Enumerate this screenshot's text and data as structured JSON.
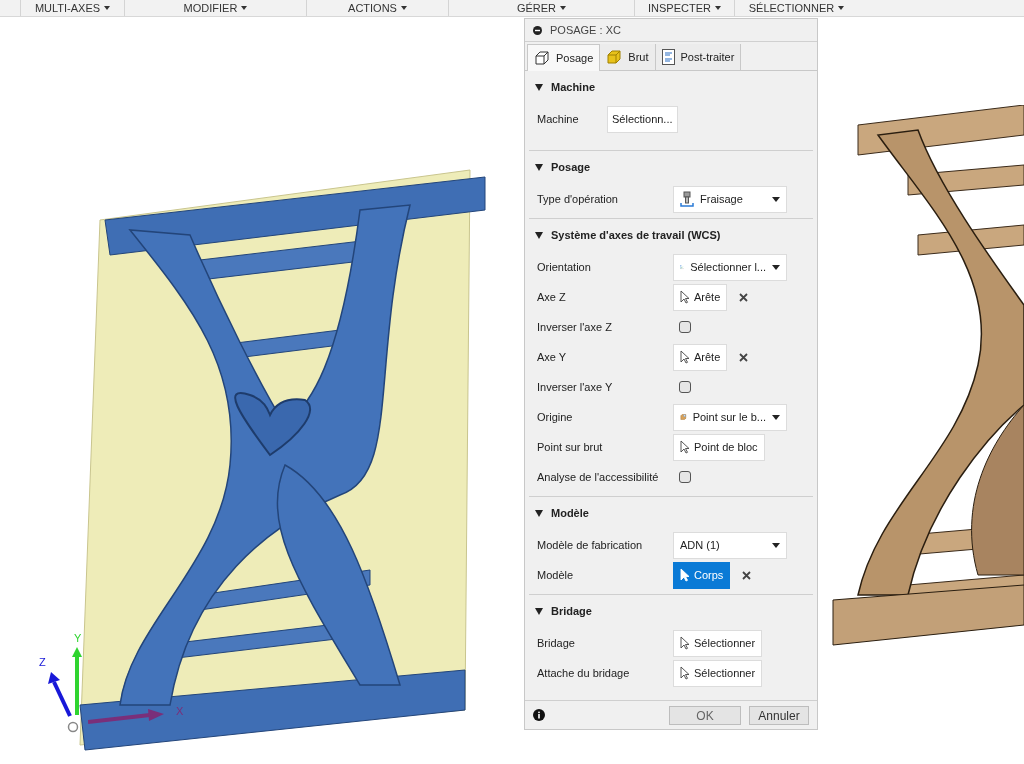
{
  "toolbar": {
    "menus": [
      {
        "label": "MULTI-AXES"
      },
      {
        "label": "MODIFIER"
      },
      {
        "label": "ACTIONS"
      },
      {
        "label": "GÉRER"
      },
      {
        "label": "INSPECTER"
      },
      {
        "label": "SÉLECTIONNER"
      }
    ]
  },
  "viewport": {
    "axis_labels": {
      "x": "X",
      "y": "Y",
      "z": "Z"
    }
  },
  "panel": {
    "title": "POSAGE : XC",
    "tabs": [
      {
        "label": "Posage",
        "selected": true
      },
      {
        "label": "Brut",
        "selected": false
      },
      {
        "label": "Post-traiter",
        "selected": false
      }
    ],
    "sections": [
      {
        "title": "Machine",
        "expanded": true,
        "rows": [
          {
            "kind": "button",
            "label": "Machine",
            "value": "Sélectionn..."
          }
        ]
      },
      {
        "title": "Posage",
        "expanded": true,
        "rows": [
          {
            "kind": "dropdown",
            "label": "Type d'opération",
            "value": "Fraisage"
          }
        ]
      },
      {
        "title": "Système d'axes de travail (WCS)",
        "expanded": true,
        "rows": [
          {
            "kind": "dropdown",
            "label": "Orientation",
            "value": "Sélectionner l..."
          },
          {
            "kind": "pick",
            "label": "Axe Z",
            "value": "Arête",
            "clearable": true,
            "selected": false
          },
          {
            "kind": "checkbox",
            "label": "Inverser l'axe Z",
            "checked": false
          },
          {
            "kind": "pick",
            "label": "Axe Y",
            "value": "Arête",
            "clearable": true,
            "selected": false
          },
          {
            "kind": "checkbox",
            "label": "Inverser l'axe Y",
            "checked": false
          },
          {
            "kind": "dropdown",
            "label": "Origine",
            "value": "Point sur le b..."
          },
          {
            "kind": "pick",
            "label": "Point sur brut",
            "value": "Point de bloc",
            "clearable": false,
            "selected": false
          },
          {
            "kind": "checkbox",
            "label": "Analyse de l'accessibilité",
            "checked": false
          }
        ]
      },
      {
        "title": "Modèle",
        "expanded": true,
        "rows": [
          {
            "kind": "dropdown",
            "label": "Modèle de fabrication",
            "value": "ADN (1)"
          },
          {
            "kind": "pick",
            "label": "Modèle",
            "value": "Corps",
            "clearable": true,
            "selected": true
          }
        ]
      },
      {
        "title": "Bridage",
        "expanded": true,
        "rows": [
          {
            "kind": "pick",
            "label": "Bridage",
            "value": "Sélectionner",
            "clearable": false,
            "selected": false
          },
          {
            "kind": "pick",
            "label": "Attache du bridage",
            "value": "Sélectionner",
            "clearable": false,
            "selected": false
          }
        ]
      }
    ],
    "buttons": {
      "ok": "OK",
      "cancel": "Annuler"
    }
  }
}
